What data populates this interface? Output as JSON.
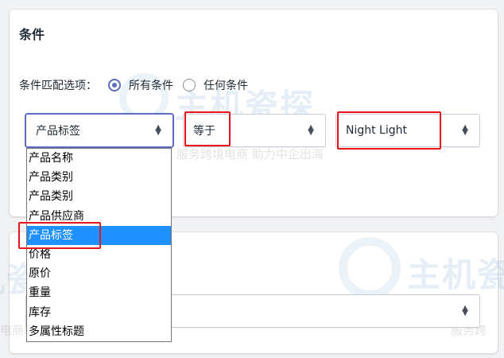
{
  "conditions": {
    "title": "条件",
    "match_label": "条件匹配选项：",
    "match_options": [
      {
        "label": "所有条件",
        "selected": true
      },
      {
        "label": "任何条件",
        "selected": false
      }
    ],
    "field_select": {
      "value": "产品标签"
    },
    "relation_select": {
      "value": "等于"
    },
    "value_input": {
      "value": "Night Light"
    },
    "field_dropdown": {
      "options": [
        "产品名称",
        "产品类别",
        "产品类别",
        "产品供应商",
        "产品标签",
        "价格",
        "原价",
        "重量",
        "库存",
        "多属性标题"
      ],
      "selected_index": 4
    }
  },
  "watermark": {
    "text_large": "主机瓷探",
    "text_small": "服务跨境电商 助力中企出海",
    "text_small_left": "电商助力中企出海",
    "text_small_right": "服务跨"
  },
  "colors": {
    "accent": "#5c6ac4",
    "highlight_box": "#e8151c",
    "dropdown_selected": "#1e90ff"
  },
  "icons": {
    "select_arrow": "up-down-arrows-icon",
    "radio": "radio-icon",
    "watermark_logo": "globe-logo"
  }
}
